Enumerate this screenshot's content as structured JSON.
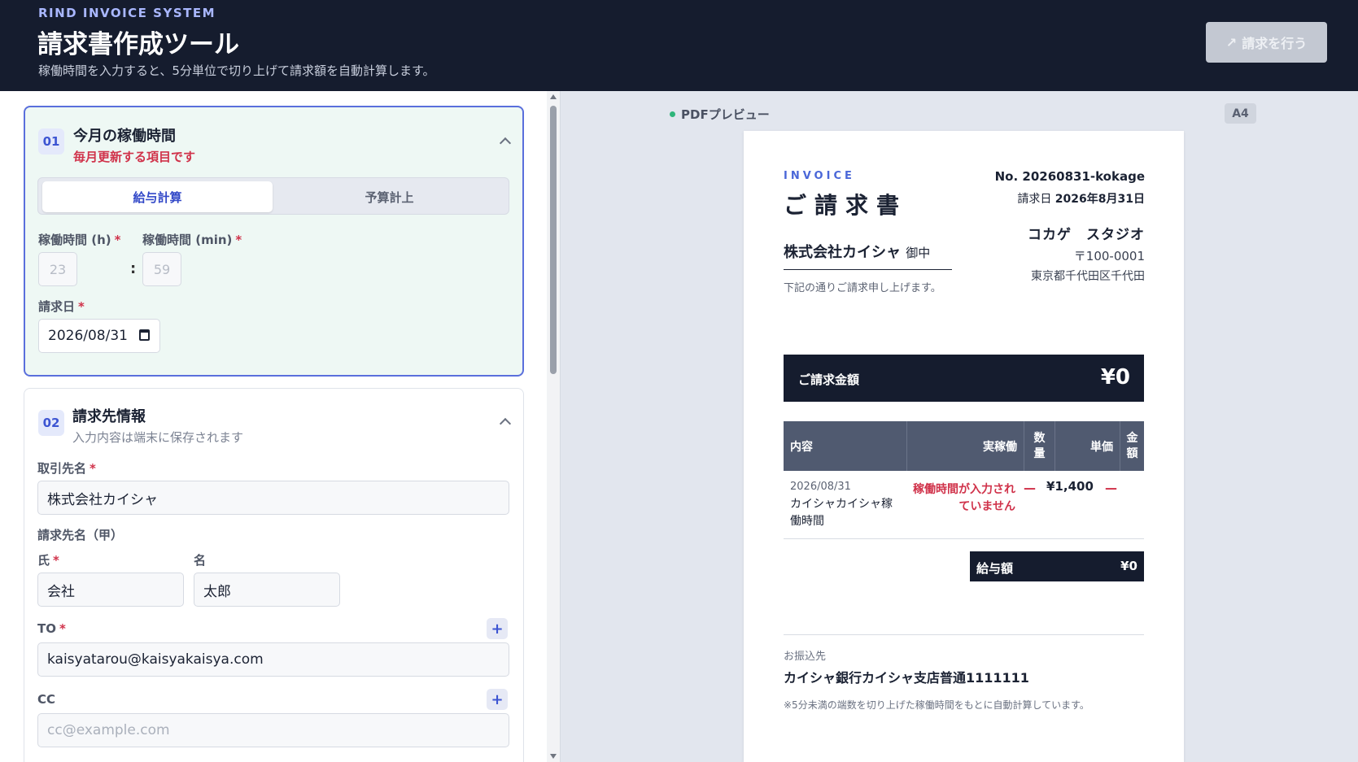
{
  "header": {
    "brand": "RIND INVOICE SYSTEM",
    "title": "請求書作成ツール",
    "subtitle": "稼働時間を入力すると、5分単位で切り上げて請求額を自動計算します。",
    "submit_icon": "↗",
    "submit_label": "請求を行う"
  },
  "section1": {
    "step": "01",
    "title": "今月の稼働時間",
    "note": "毎月更新する項目です",
    "tabs": [
      "給与計算",
      "予算計上"
    ],
    "active_tab": "給与計算",
    "hours_label": "稼働時間 (h)",
    "minutes_label": "稼働時間 (min)",
    "required_mark": "*",
    "hours_value": "23",
    "minutes_value": "59",
    "colon": ":",
    "date_label": "請求日",
    "date_value": "2026/08/31"
  },
  "section2": {
    "step": "02",
    "title": "請求先情報",
    "note": "入力内容は端末に保存されます",
    "client_label": "取引先名",
    "client_value": "株式会社カイシャ",
    "recipient_label": "請求先名（甲）",
    "last_name_label": "氏",
    "last_name_value": "会社",
    "first_name_label": "名",
    "first_name_value": "太郎",
    "to_label": "TO",
    "to_value": "kaisyatarou@kaisyakaisya.com",
    "cc_label": "CC",
    "cc_placeholder": "cc@example.com",
    "add_symbol": "+"
  },
  "preview": {
    "label": "PDFプレビュー",
    "paper_size": "A4",
    "invoice": {
      "en_title": "INVOICE",
      "ja_title": "ご請求書",
      "number": "No. 20260831-kokage",
      "date_label": "請求日",
      "date_value": "2026年8月31日",
      "client": "株式会社カイシャ",
      "honorific": "御中",
      "greeting": "下記の通りご請求申し上げます。",
      "issuer": "コカゲ　スタジオ",
      "zip": "〒100-0001",
      "address": "東京都千代田区千代田",
      "total_label": "ご請求金額",
      "total_value": "¥0",
      "table_headers": {
        "content": "内容",
        "actual": "実稼働",
        "qty": [
          "数",
          "量"
        ],
        "unit_price": "単価",
        "amount": [
          "金",
          "額"
        ]
      },
      "row": {
        "date": "2026/08/31",
        "description": "カイシャカイシャ稼働時間",
        "actual": "稼働時間が入力されていません",
        "qty": "—",
        "unit_price": "¥1,400",
        "amount": "—"
      },
      "subtotal_label": "給与額",
      "subtotal_value": "¥0",
      "bank_label": "お振込先",
      "bank_value": "カイシャ銀行カイシャ支店普通1111111",
      "footnote": "※5分未満の端数を切り上げた稼働時間をもとに自動計算しています。"
    }
  },
  "colors": {
    "header_bg": "#151c2e",
    "accent": "#3d55d2",
    "required": "#d0324a",
    "card_active_bg": "#eef8f4"
  },
  "icons": {
    "collapse": "chevron-up-icon",
    "calendar": "calendar-icon",
    "status_dot": "green-dot-icon"
  }
}
